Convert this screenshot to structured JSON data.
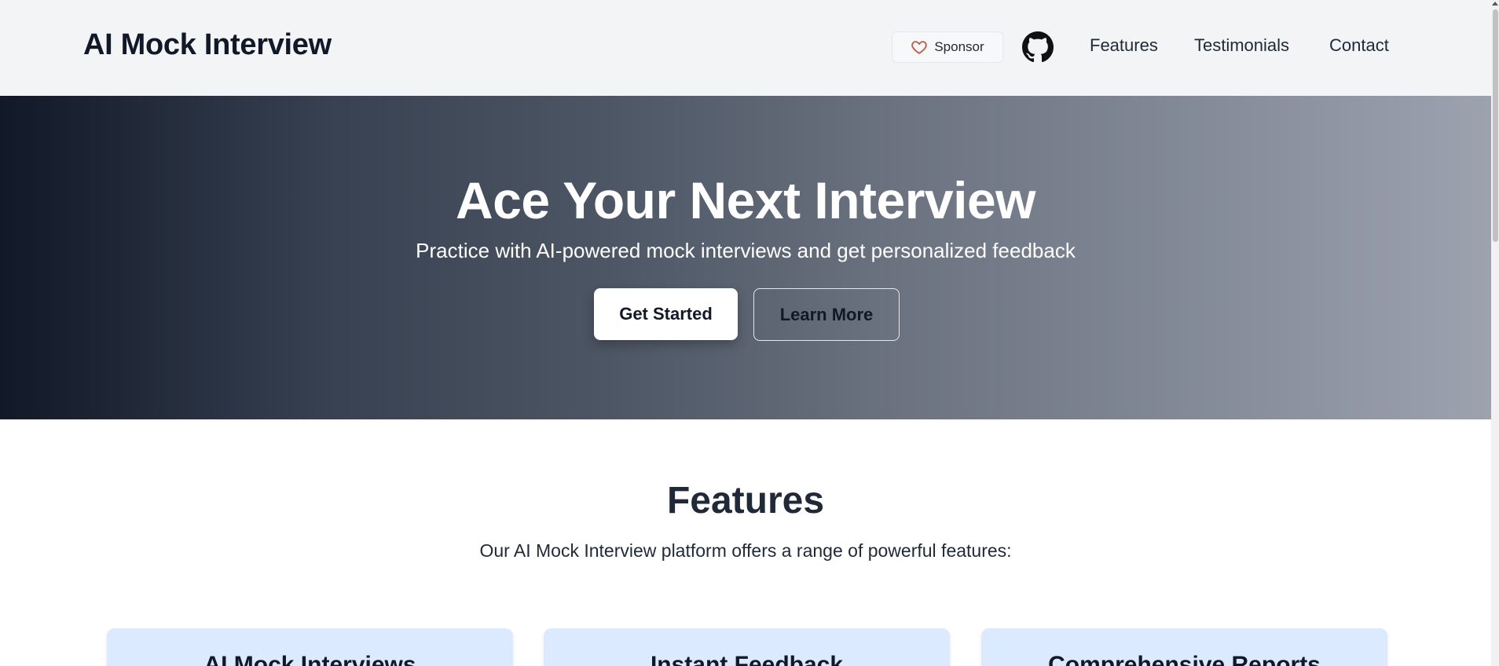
{
  "header": {
    "brand": "AI Mock Interview",
    "sponsor_label": "Sponsor",
    "github_icon": "github-icon",
    "nav": [
      {
        "label": "Features"
      },
      {
        "label": "Testimonials"
      },
      {
        "label": "Contact"
      }
    ]
  },
  "hero": {
    "title": "Ace Your Next Interview",
    "subtitle": "Practice with AI-powered mock interviews and get personalized feedback",
    "primary_button": "Get Started",
    "secondary_button": "Learn More"
  },
  "features": {
    "title": "Features",
    "subtitle": "Our AI Mock Interview platform offers a range of powerful features:",
    "cards": [
      {
        "title": "AI Mock Interviews"
      },
      {
        "title": "Instant Feedback"
      },
      {
        "title": "Comprehensive Reports"
      }
    ]
  },
  "colors": {
    "header_bg": "#f3f4f6",
    "hero_gradient_start": "#111827",
    "hero_gradient_end": "#9ca3af",
    "card_bg": "#dbeafe",
    "heart": "#bf5b3f"
  }
}
